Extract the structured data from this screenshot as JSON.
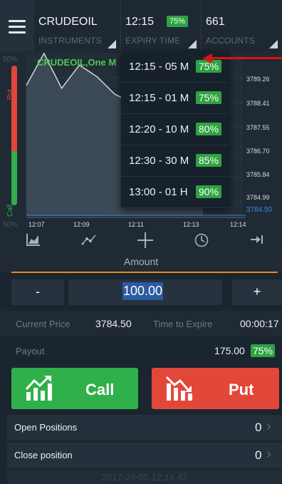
{
  "header": {
    "instrument": "CRUDEOIL",
    "instrument_label": "INSTRUMENTS",
    "expiry": "12:15",
    "expiry_pct": "75%",
    "expiry_label": "EXPIRY TIME",
    "accounts": "661",
    "accounts_label": "ACCOUNTS"
  },
  "chart": {
    "title": "CRUDEOIL,One M",
    "put_label": "Put",
    "call_label": "Call",
    "pct_top": "50%",
    "pct_bottom": "50%"
  },
  "chart_data": {
    "type": "area",
    "series": [
      {
        "values": [
          3789.0,
          3790.1,
          3788.9,
          3789.7,
          3789.3,
          3788.7,
          3788.4,
          3788.2,
          3787.9,
          3787.6,
          3787.3
        ]
      }
    ],
    "x": [
      "12:07",
      "12:08",
      "12:09",
      "12:10",
      "12:10",
      "12:11",
      "12:11",
      "12:12",
      "12:12",
      "12:13",
      "12:13"
    ],
    "x_ticks": [
      "12:07",
      "12:09",
      "12:11",
      "12:13",
      "12:14"
    ],
    "y_ticks": [
      "3789.26",
      "3788.41",
      "3787.55",
      "3786.70",
      "3785.84",
      "3784.99"
    ],
    "current_price_label": "3784.50",
    "ylim": [
      3784.5,
      3790.1
    ]
  },
  "dropdown": {
    "items": [
      {
        "label": "12:15 - 05 M",
        "pct": "75%"
      },
      {
        "label": "12:15 - 01 M",
        "pct": "75%"
      },
      {
        "label": "12:20 - 10 M",
        "pct": "80%"
      },
      {
        "label": "12:30 - 30 M",
        "pct": "85%"
      },
      {
        "label": "13:00 - 01 H",
        "pct": "90%"
      }
    ]
  },
  "toolbar": {
    "icons": [
      "chart-type-icon",
      "indicators-icon",
      "crosshair-icon",
      "clock-icon",
      "scroll-end-icon"
    ]
  },
  "amount": {
    "label": "Amount",
    "minus": "-",
    "plus": "+",
    "value": "100.00"
  },
  "trade": {
    "current_price_label": "Current Price",
    "current_price": "3784.50",
    "time_to_expire_label": "Time to Expire",
    "time_to_expire": "00:00:17",
    "payout_label": "Payout",
    "payout_value": "175.00",
    "payout_pct": "75%",
    "call_label": "Call",
    "put_label": "Put"
  },
  "positions": {
    "open_label": "Open Positions",
    "open_count": "0",
    "close_label": "Close position",
    "close_count": "0",
    "chevron": "›"
  },
  "footer": {
    "datetime": "2017-24-05 12:14:42"
  },
  "colors": {
    "call_green": "#2fb04a",
    "put_red": "#e2483a",
    "badge_green": "#2ea342",
    "accent_orange": "#e38a1f",
    "annotation_red": "#e01111"
  }
}
